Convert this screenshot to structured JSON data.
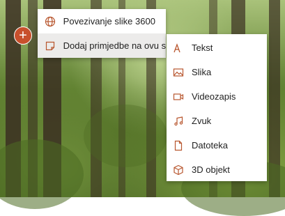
{
  "accent_color": "#c8502c",
  "add_button": {
    "glyph": "+"
  },
  "primary_menu": {
    "items": [
      {
        "label": "Povezivanje slike 3600",
        "icon": "globe-icon"
      },
      {
        "label": "Dodaj primjedbe na ovu sliku",
        "icon": "note-icon"
      }
    ]
  },
  "sub_menu": {
    "items": [
      {
        "label": "Tekst",
        "icon": "text-icon"
      },
      {
        "label": "Slika",
        "icon": "image-icon"
      },
      {
        "label": "Videozapis",
        "icon": "video-icon"
      },
      {
        "label": "Zvuk",
        "icon": "music-icon"
      },
      {
        "label": "Datoteka",
        "icon": "file-icon"
      },
      {
        "label": "3D objekt",
        "icon": "cube-icon"
      }
    ]
  }
}
